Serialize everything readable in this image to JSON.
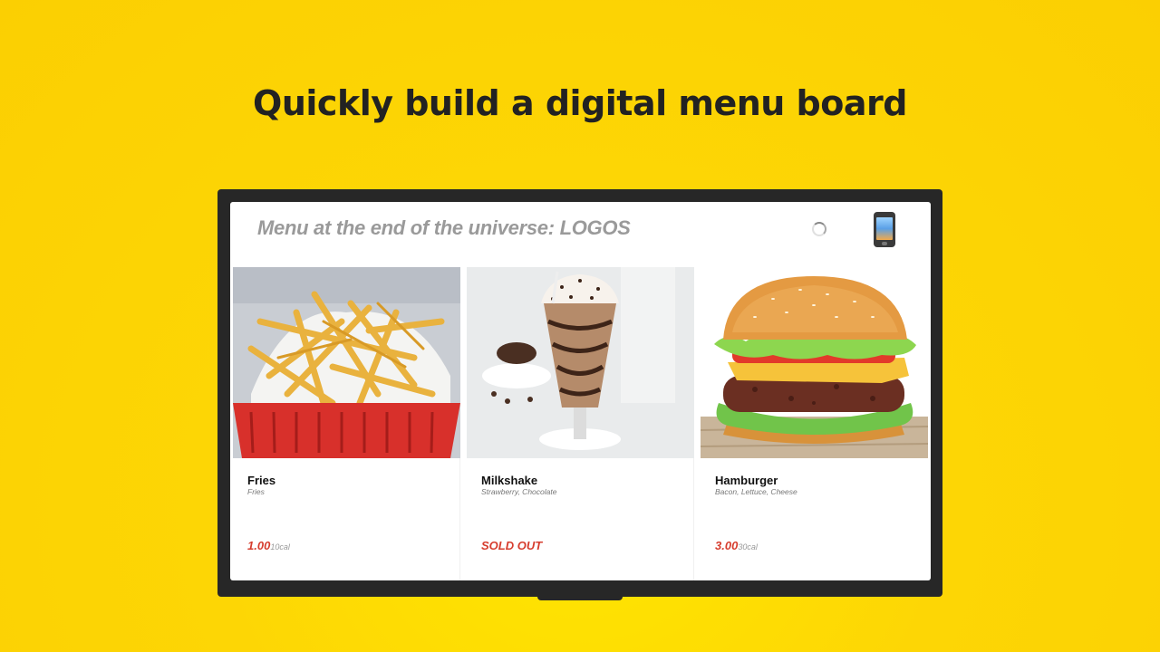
{
  "headline": "Quickly build a digital menu board",
  "screen": {
    "menu_title": "Menu at the end of the universe: LOGOS",
    "status_icon": "loading-spinner-icon",
    "device_icon": "mobile-phone-icon"
  },
  "items": [
    {
      "name": "Fries",
      "description": "Fries",
      "price": "1.00",
      "calories": "10cal",
      "image": "fries-photo"
    },
    {
      "name": "Milkshake",
      "description": "Strawberry, Chocolate",
      "price": "SOLD OUT",
      "calories": "",
      "image": "milkshake-photo"
    },
    {
      "name": "Hamburger",
      "description": "Bacon, Lettuce, Cheese",
      "price": "3.00",
      "calories": "30cal",
      "image": "hamburger-photo"
    }
  ],
  "colors": {
    "background": "#fbcf02",
    "tv_frame": "#272727",
    "price": "#d63d2e",
    "title": "#9a9a9a"
  }
}
